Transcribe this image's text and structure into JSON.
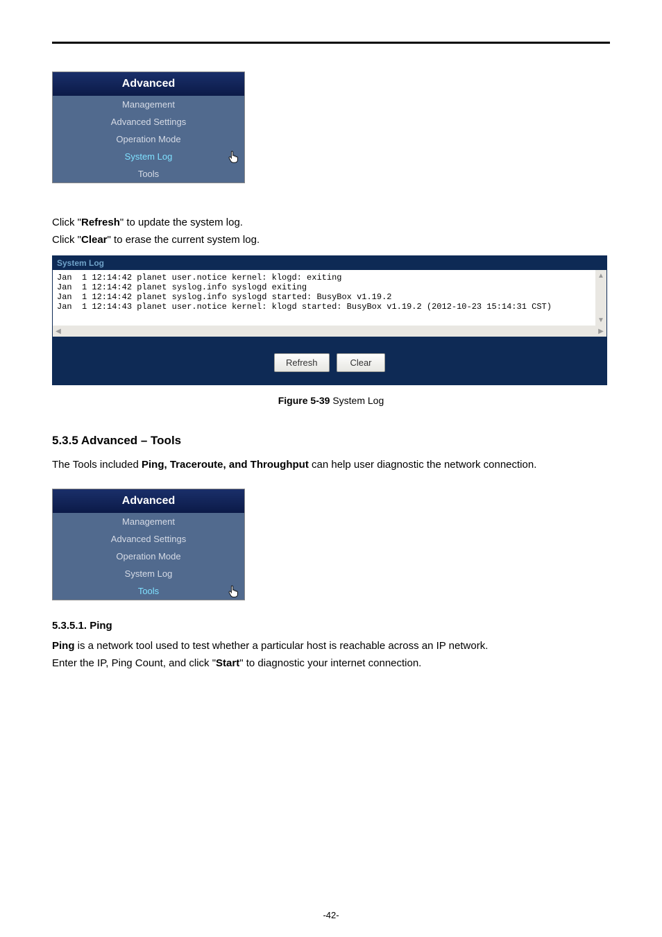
{
  "menu1": {
    "header": "Advanced",
    "items": [
      "Management",
      "Advanced Settings",
      "Operation Mode",
      "System Log",
      "Tools"
    ],
    "active_index": 3
  },
  "para_refresh_pre": "Click \"",
  "para_refresh_bold": "Refresh",
  "para_refresh_post": "\" to update the system log.",
  "para_clear_pre": "Click \"",
  "para_clear_bold": "Clear",
  "para_clear_post": "\" to erase the current system log.",
  "syslog": {
    "title": "System Log",
    "lines": "Jan  1 12:14:42 planet user.notice kernel: klogd: exiting\nJan  1 12:14:42 planet syslog.info syslogd exiting\nJan  1 12:14:42 planet syslog.info syslogd started: BusyBox v1.19.2\nJan  1 12:14:43 planet user.notice kernel: klogd started: BusyBox v1.19.2 (2012-10-23 15:14:31 CST)",
    "btn_refresh": "Refresh",
    "btn_clear": "Clear"
  },
  "figure_caption_bold": "Figure 5-39",
  "figure_caption_rest": " System Log",
  "section535_num": "5.3.5",
  "section535_title": "  Advanced – Tools",
  "tools_intro_pre": "The Tools included ",
  "tools_intro_bold": "Ping, Traceroute, and Throughput",
  "tools_intro_post": " can help user diagnostic the network connection.",
  "menu2": {
    "header": "Advanced",
    "items": [
      "Management",
      "Advanced Settings",
      "Operation Mode",
      "System Log",
      "Tools"
    ],
    "active_index": 4
  },
  "section5351_num": "5.3.5.1.",
  "section5351_title": "  Ping",
  "ping_desc_bold": "Ping",
  "ping_desc_rest": " is a network tool used to test whether a particular host is reachable across an IP network.",
  "ping_enter_pre": "Enter the IP, Ping Count, and click \"",
  "ping_enter_bold": "Start",
  "ping_enter_post": "\" to diagnostic your internet connection.",
  "page_number": "-42-"
}
